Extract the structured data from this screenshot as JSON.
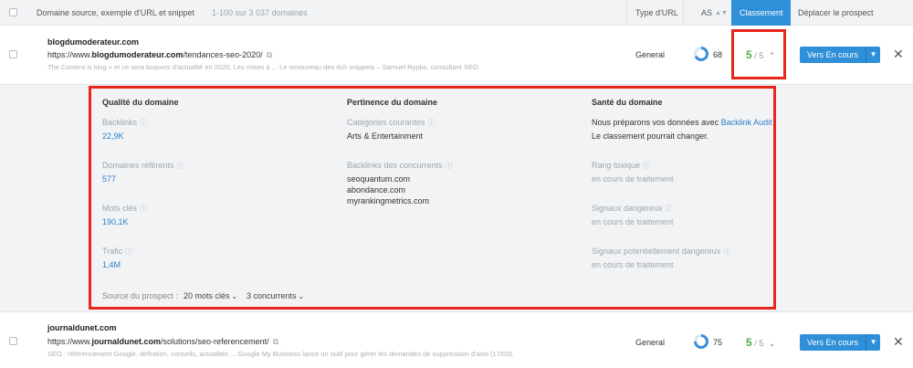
{
  "header": {
    "col_domain": "Domaine source, exemple d'URL et snippet",
    "count_text": "1-100 sur 3 037 domaines",
    "col_type": "Type d'URL",
    "col_as": "AS",
    "col_rank": "Classement",
    "col_move": "Déplacer le prospect"
  },
  "rows": [
    {
      "domain": "blogdumoderateur.com",
      "url_prefix": "https://www.",
      "url_bold": "blogdumoderateur.com",
      "url_path": "/tendances-seo-2020/",
      "snippet": "The Content is king » et ce sera toujours d'actualité en 2020. Les mises à ... Le renouveau des rich snippets – Samuel Rypko, consultant SEO.",
      "type": "General",
      "as": "68",
      "rank_value": "5",
      "rank_total": "/ 5",
      "button": "Vers En cours"
    },
    {
      "domain": "journaldunet.com",
      "url_prefix": "https://www.",
      "url_bold": "journaldunet.com",
      "url_path": "/solutions/seo-referencement/",
      "snippet": "SEO : référencement Google, définition, conseils, actualités ... Google My Business lance un outil pour gérer les demandes de suppression d'avis (17/03).",
      "type": "General",
      "as": "75",
      "rank_value": "5",
      "rank_total": "/ 5",
      "button": "Vers En cours"
    }
  ],
  "panel": {
    "quality_title": "Qualité du domaine",
    "backlinks_label": "Backlinks",
    "backlinks_value": "22,9K",
    "ref_domains_label": "Domaines référents",
    "ref_domains_value": "577",
    "keywords_label": "Mots clés",
    "keywords_value": "190,1K",
    "traffic_label": "Trafic",
    "traffic_value": "1,4M",
    "relevance_title": "Pertinence du domaine",
    "categories_label": "Catégories courantes",
    "categories_value": "Arts & Entertainment",
    "competitor_backlinks_label": "Backlinks des concurrents",
    "competitors": [
      "seoquantum.com",
      "abondance.com",
      "myrankingmetrics.com"
    ],
    "health_title": "Santé du domaine",
    "health_msg_pre": "Nous préparons vos données avec ",
    "health_msg_link": "Backlink Audit",
    "health_msg_2": "Le classement pourrait changer.",
    "toxic_label": "Rang toxique",
    "toxic_value": "en cours de traitement",
    "danger_label": "Signaux dangereux",
    "danger_value": "en cours de traitement",
    "potential_label": "Signaux potentiellement dangereux",
    "potential_value": "en cours de traitement",
    "source_label": "Source du prospect :",
    "source_keywords": "20 mots clés",
    "source_competitors": "3 concurrents"
  },
  "colors": {
    "accent": "#2f8fd9",
    "rank_green": "#4caf50",
    "highlight_red": "#e8261b",
    "panel_bg": "#f1f3f5"
  }
}
